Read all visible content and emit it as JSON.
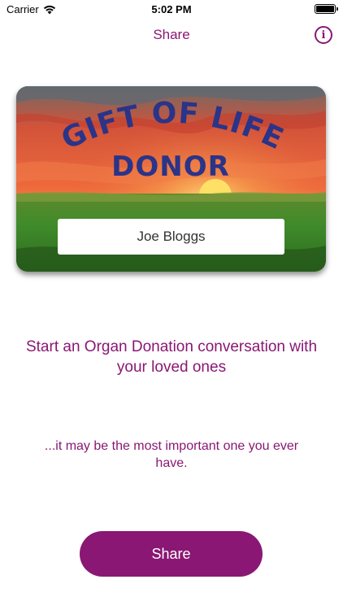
{
  "status_bar": {
    "carrier": "Carrier",
    "time": "5:02 PM"
  },
  "nav": {
    "title": "Share",
    "info_icon": "info-icon"
  },
  "card": {
    "title_line1": "GIFT OF LIFE",
    "title_line2": "DONOR",
    "name": "Joe Bloggs"
  },
  "headline": "Start an Organ Donation conversation with your loved ones",
  "subline": "...it may be the most important one you ever have.",
  "share_button": {
    "label": "Share"
  },
  "colors": {
    "accent": "#8a1773",
    "card_title": "#2a3488"
  }
}
